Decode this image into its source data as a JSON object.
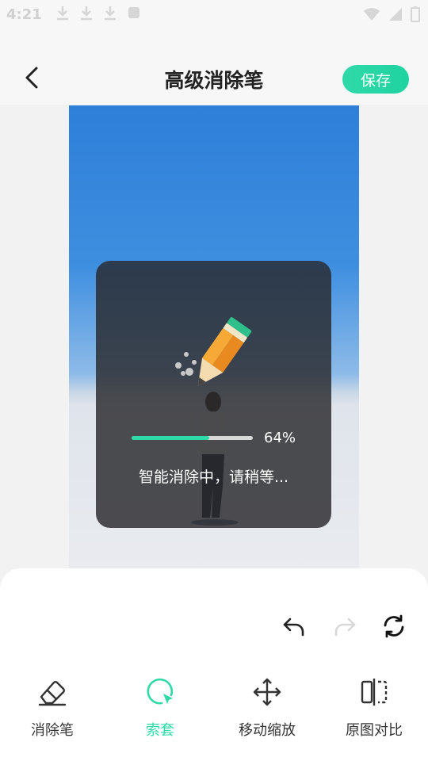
{
  "status_bar": {
    "time": "4:21"
  },
  "header": {
    "title": "高级消除笔",
    "save_label": "保存"
  },
  "processing": {
    "progress_percent": 64,
    "progress_label": "64%",
    "message": "智能消除中，请稍等..."
  },
  "toolbar": {
    "tools": [
      {
        "label": "消除笔",
        "icon": "eraser-icon",
        "active": false
      },
      {
        "label": "索套",
        "icon": "lasso-icon",
        "active": true
      },
      {
        "label": "移动缩放",
        "icon": "move-icon",
        "active": false
      },
      {
        "label": "原图对比",
        "icon": "compare-icon",
        "active": false
      }
    ]
  },
  "colors": {
    "accent": "#2fd9a8"
  }
}
